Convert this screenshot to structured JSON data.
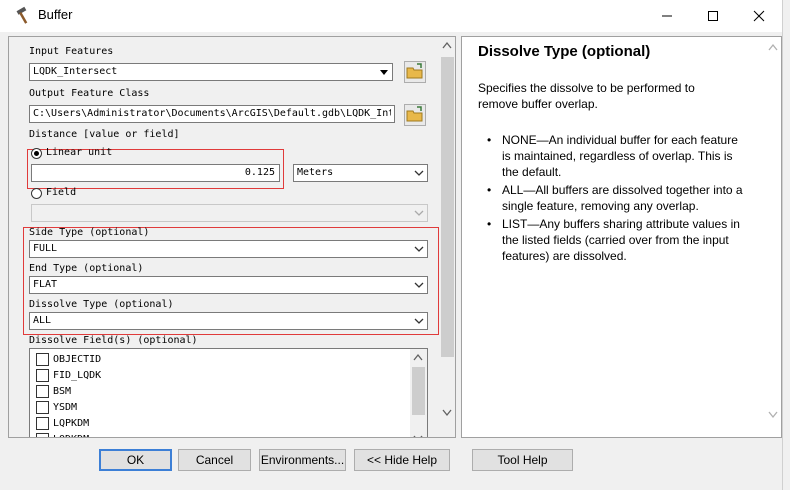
{
  "window": {
    "title": "Buffer"
  },
  "form": {
    "input_features": {
      "label": "Input Features",
      "value": "LQDK_Intersect"
    },
    "output_feature_class": {
      "label": "Output Feature Class",
      "value": "C:\\Users\\Administrator\\Documents\\ArcGIS\\Default.gdb\\LQDK_Int"
    },
    "distance": {
      "label": "Distance [value or field]",
      "linear_unit_label": "Linear unit",
      "linear_unit_selected": true,
      "value": "0.125",
      "unit": "Meters",
      "field_label": "Field",
      "field_selected": false,
      "field_value": ""
    },
    "side_type": {
      "label": "Side Type (optional)",
      "value": "FULL"
    },
    "end_type": {
      "label": "End Type (optional)",
      "value": "FLAT"
    },
    "dissolve_type": {
      "label": "Dissolve Type (optional)",
      "value": "ALL"
    },
    "dissolve_fields": {
      "label": "Dissolve Field(s) (optional)",
      "items": [
        {
          "name": "OBJECTID",
          "checked": false
        },
        {
          "name": "FID_LQDK",
          "checked": false
        },
        {
          "name": "BSM",
          "checked": false
        },
        {
          "name": "YSDM",
          "checked": false
        },
        {
          "name": "LQPKDM",
          "checked": false
        },
        {
          "name": "LQDKDM",
          "checked": false
        }
      ]
    }
  },
  "help": {
    "title": "Dissolve Type (optional)",
    "description": "Specifies the dissolve to be performed to remove buffer overlap.",
    "bullets": [
      "NONE—An individual buffer for each feature is maintained, regardless of overlap. This is the default.",
      "ALL—All buffers are dissolved together into a single feature, removing any overlap.",
      "LIST—Any buffers sharing attribute values in the listed fields (carried over from the input features) are dissolved."
    ]
  },
  "buttons": {
    "ok": "OK",
    "cancel": "Cancel",
    "environments": "Environments...",
    "hide_help": "<< Hide Help",
    "tool_help": "Tool Help"
  },
  "colors": {
    "highlight_box": "#e03b3b",
    "default_button_border": "#3c7fd6"
  },
  "icons": {
    "title": "hammer-icon",
    "open": "open-folder-icon",
    "dropdown": "chevron-down-icon"
  }
}
